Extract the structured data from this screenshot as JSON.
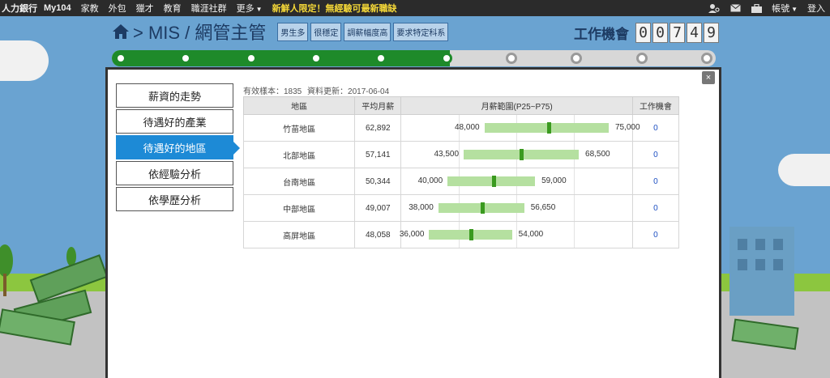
{
  "topnav": {
    "items": [
      "人力銀行",
      "My104",
      "家教",
      "外包",
      "獵才",
      "教育",
      "職涯社群",
      "更多"
    ],
    "promo": "新鮮人限定！無經驗可最新職缺",
    "account": "帳號",
    "login": "登入"
  },
  "header": {
    "title": "> MIS / 網管主管",
    "tags": [
      "男生多",
      "很穩定",
      "調薪幅度高",
      "要求特定科系"
    ],
    "jobs_label": "工作機會",
    "jobs_digits": [
      "0",
      "0",
      "7",
      "4",
      "9"
    ]
  },
  "progress": {
    "value": 0.56,
    "steps": 10,
    "completed_steps": 6
  },
  "modal": {
    "close": "×",
    "menu": [
      "薪資的走勢",
      "待遇好的產業",
      "待遇好的地區",
      "依經驗分析",
      "依學歷分析"
    ],
    "active_index": 2,
    "meta": {
      "samples": "有效樣本：1835",
      "updated": "資料更新：2017-06-04"
    },
    "table": {
      "headers": [
        "地區",
        "平均月薪",
        "月薪範圍(P25~P75)",
        "工作機會"
      ],
      "rows": [
        {
          "region": "竹苗地區",
          "avg": "62,892",
          "p25": "48,000",
          "p75": "75,000",
          "lo": 48000,
          "hi": 75000,
          "median": 62000,
          "jobs": "0"
        },
        {
          "region": "北部地區",
          "avg": "57,141",
          "p25": "43,500",
          "p75": "68,500",
          "lo": 43500,
          "hi": 68500,
          "median": 56000,
          "jobs": "0"
        },
        {
          "region": "台南地區",
          "avg": "50,344",
          "p25": "40,000",
          "p75": "59,000",
          "lo": 40000,
          "hi": 59000,
          "median": 50000,
          "jobs": "0"
        },
        {
          "region": "中部地區",
          "avg": "49,007",
          "p25": "38,000",
          "p75": "56,650",
          "lo": 38000,
          "hi": 56650,
          "median": 47500,
          "jobs": "0"
        },
        {
          "region": "高屏地區",
          "avg": "48,058",
          "p25": "36,000",
          "p75": "54,000",
          "lo": 36000,
          "hi": 54000,
          "median": 45000,
          "jobs": "0"
        }
      ]
    }
  },
  "colors": {
    "active_menu": "#1d8ad6",
    "progress": "#1e8a2a",
    "range_bar": "#b5e0a0",
    "median": "#3a9a1f"
  }
}
